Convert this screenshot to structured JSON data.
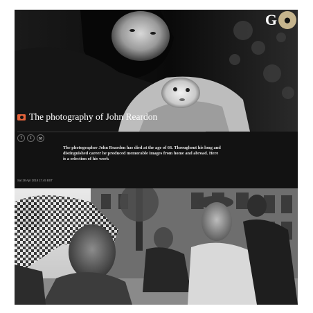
{
  "brand": {
    "logo_letter": "G"
  },
  "article": {
    "title": "The photography of John Reardon",
    "standfirst": "The photographer John Reardon has died at the age of 66. Throughout his long and distinguished career he produced memorable images from home and abroad. Here is a selection of his work",
    "dateline": "Sat 28 Apr 2018 17.45 BST"
  },
  "share": {
    "buttons": [
      {
        "icon": "facebook-icon",
        "glyph": "f"
      },
      {
        "icon": "twitter-icon",
        "glyph": "t"
      },
      {
        "icon": "email-icon",
        "glyph": "✉"
      }
    ]
  },
  "colors": {
    "background": "#121212",
    "camera_accent": "#e6643c",
    "logo_circle": "#c5b48d"
  }
}
